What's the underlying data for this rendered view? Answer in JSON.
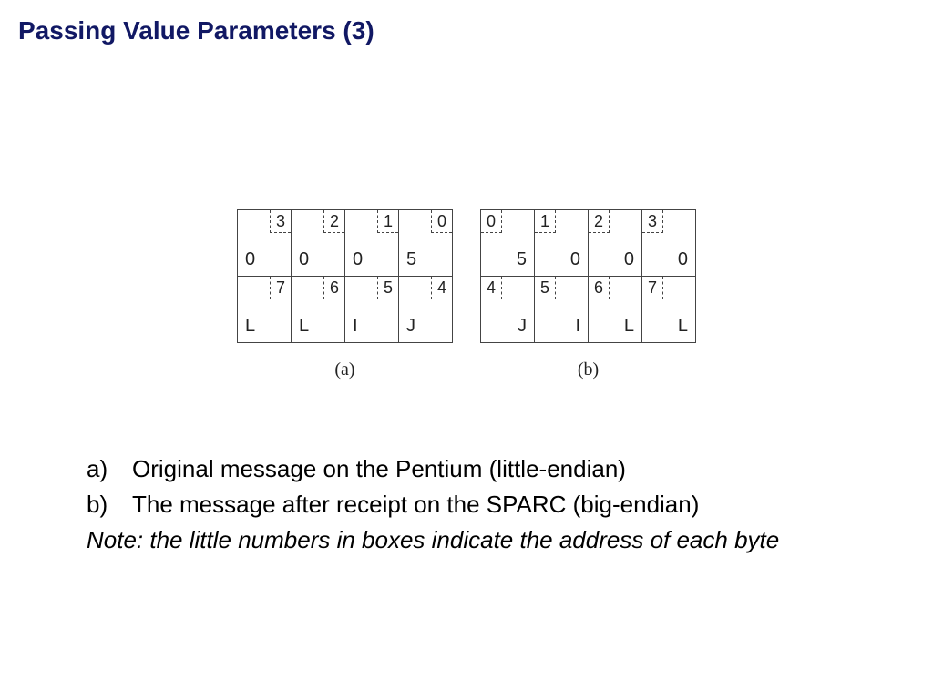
{
  "title": "Passing Value Parameters (3)",
  "tables": {
    "a": {
      "label": "(a)",
      "addr_side": "right",
      "content_align": "left",
      "rows": [
        {
          "cells": [
            {
              "addr": "3",
              "val": "0"
            },
            {
              "addr": "2",
              "val": "0"
            },
            {
              "addr": "1",
              "val": "0"
            },
            {
              "addr": "0",
              "val": "5"
            }
          ]
        },
        {
          "cells": [
            {
              "addr": "7",
              "val": "L"
            },
            {
              "addr": "6",
              "val": "L"
            },
            {
              "addr": "5",
              "val": "I"
            },
            {
              "addr": "4",
              "val": "J"
            }
          ]
        }
      ]
    },
    "b": {
      "label": "(b)",
      "addr_side": "left",
      "content_align": "right",
      "rows": [
        {
          "cells": [
            {
              "addr": "0",
              "val": "5"
            },
            {
              "addr": "1",
              "val": "0"
            },
            {
              "addr": "2",
              "val": "0"
            },
            {
              "addr": "3",
              "val": "0"
            }
          ]
        },
        {
          "cells": [
            {
              "addr": "4",
              "val": "J"
            },
            {
              "addr": "5",
              "val": "I"
            },
            {
              "addr": "6",
              "val": "L"
            },
            {
              "addr": "7",
              "val": "L"
            }
          ]
        }
      ]
    }
  },
  "bullets": {
    "a": {
      "marker": "a)",
      "text": "Original message on the Pentium (little-endian)"
    },
    "b": {
      "marker": "b)",
      "text": "The message after receipt on the SPARC (big-endian)"
    }
  },
  "note": "Note: the little numbers in boxes indicate the address of each byte"
}
